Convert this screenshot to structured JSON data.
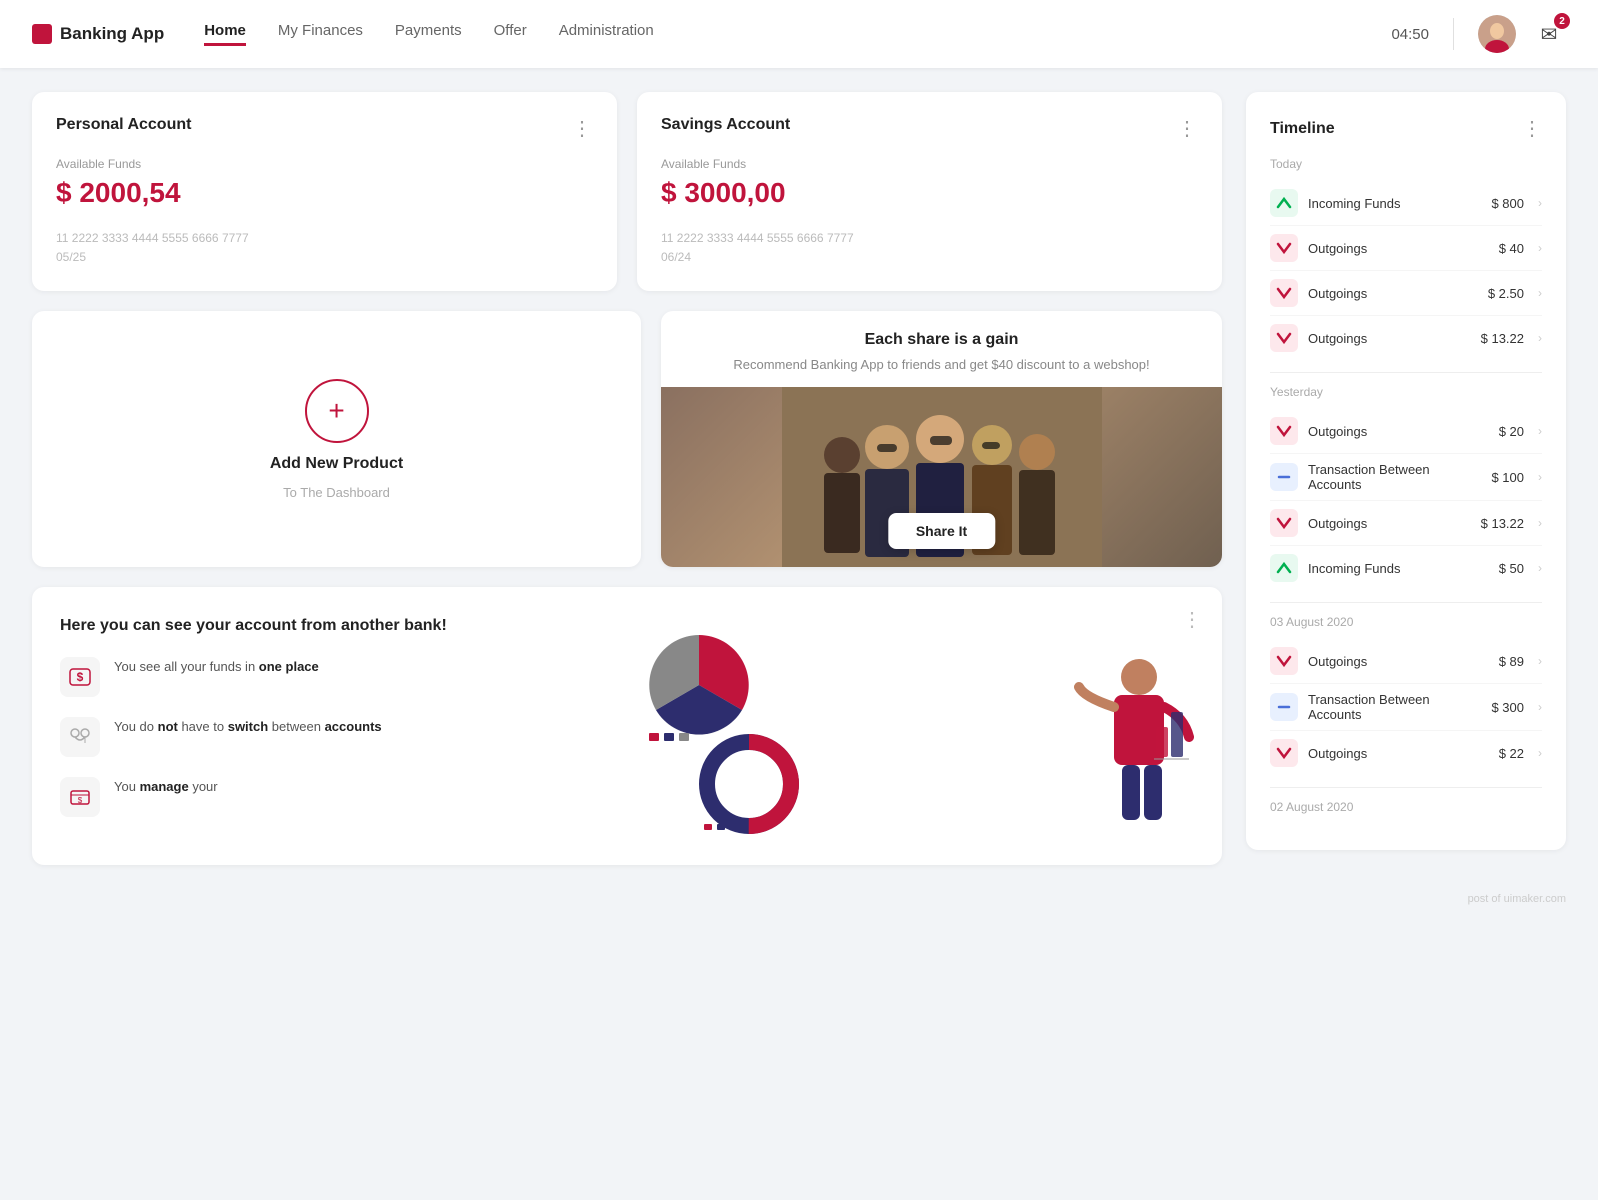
{
  "nav": {
    "logo": "Banking App",
    "links": [
      {
        "label": "Home",
        "active": true
      },
      {
        "label": "My Finances",
        "active": false
      },
      {
        "label": "Payments",
        "active": false
      },
      {
        "label": "Offer",
        "active": false
      },
      {
        "label": "Administration",
        "active": false
      }
    ],
    "time": "04:50",
    "badge": "2"
  },
  "personalAccount": {
    "title": "Personal Account",
    "label": "Available Funds",
    "amount": "$ 2000,54",
    "cardNumber": "11 2222 3333 4444 5555 6666 7777",
    "expiry": "05/25"
  },
  "savingsAccount": {
    "title": "Savings Account",
    "label": "Available Funds",
    "amount": "$ 3000,00",
    "cardNumber": "11 2222 3333 4444 5555 6666 7777",
    "expiry": "06/24"
  },
  "addProduct": {
    "title": "Add New Product",
    "subtitle": "To The Dashboard",
    "plus": "+"
  },
  "shareCard": {
    "title": "Each share is a gain",
    "description": "Recommend Banking App to friends and get $40 discount to a webshop!",
    "buttonLabel": "Share It"
  },
  "bankSection": {
    "title": "Here you can see your account from another bank!",
    "features": [
      {
        "icon": "$",
        "text_before": "You see all your funds in ",
        "bold": "one place",
        "text_after": ""
      },
      {
        "icon": "⇄",
        "text1": "You do ",
        "bold1": "not",
        "text2": " have to ",
        "bold2": "switch",
        "text3": " between ",
        "bold3": "accounts",
        "text4": ""
      },
      {
        "icon": "$",
        "text1": "You ",
        "bold1": "manage",
        "text2": " your"
      }
    ]
  },
  "timeline": {
    "title": "Timeline",
    "sections": [
      {
        "dateLabel": "Today",
        "items": [
          {
            "type": "green",
            "label": "Incoming Funds",
            "amount": "$ 800",
            "icon": "↗"
          },
          {
            "type": "red",
            "label": "Outgoings",
            "amount": "$ 40",
            "icon": "↘"
          },
          {
            "type": "red",
            "label": "Outgoings",
            "amount": "$ 2.50",
            "icon": "↘"
          },
          {
            "type": "red",
            "label": "Outgoings",
            "amount": "$ 13.22",
            "icon": "↘"
          }
        ]
      },
      {
        "dateLabel": "Yesterday",
        "items": [
          {
            "type": "red",
            "label": "Outgoings",
            "amount": "$ 20",
            "icon": "↘"
          },
          {
            "type": "blue",
            "label": "Transaction Between Accounts",
            "amount": "$ 100",
            "icon": "—"
          },
          {
            "type": "red",
            "label": "Outgoings",
            "amount": "$ 13.22",
            "icon": "↘"
          },
          {
            "type": "green",
            "label": "Incoming Funds",
            "amount": "$ 50",
            "icon": "↗"
          }
        ]
      },
      {
        "dateLabel": "03 August 2020",
        "items": [
          {
            "type": "red",
            "label": "Outgoings",
            "amount": "$ 89",
            "icon": "↘"
          },
          {
            "type": "blue",
            "label": "Transaction Between Accounts",
            "amount": "$ 300",
            "icon": "—"
          },
          {
            "type": "red",
            "label": "Outgoings",
            "amount": "$ 22",
            "icon": "↘"
          }
        ]
      },
      {
        "dateLabel": "02 August 2020",
        "items": []
      }
    ]
  },
  "footer": "post of uimaker.com"
}
